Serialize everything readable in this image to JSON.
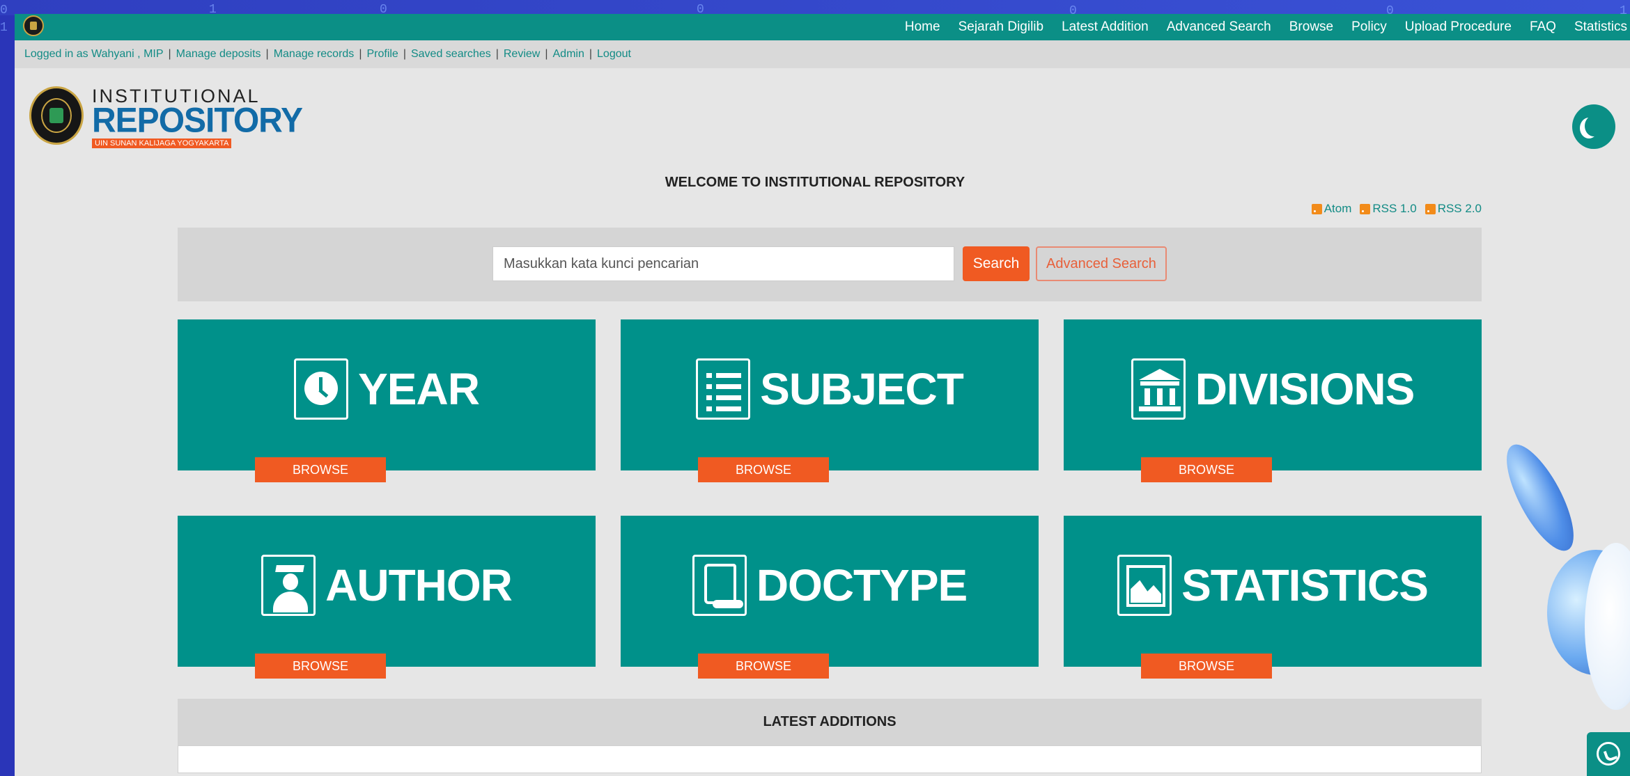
{
  "topnav": {
    "items": [
      "Home",
      "Sejarah Digilib",
      "Latest Addition",
      "Advanced Search",
      "Browse",
      "Policy",
      "Upload Procedure",
      "FAQ",
      "Statistics"
    ]
  },
  "userbar": {
    "logged_in": "Logged in as Wahyani , MIP",
    "links": [
      "Manage deposits",
      "Manage records",
      "Profile",
      "Saved searches",
      "Review",
      "Admin",
      "Logout"
    ]
  },
  "logo": {
    "line1": "INSTITUTIONAL",
    "line2": "REPOSITORY",
    "line3": "UIN SUNAN KALIJAGA YOGYAKARTA"
  },
  "welcome": "WELCOME TO INSTITUTIONAL REPOSITORY",
  "feeds": [
    "Atom",
    "RSS 1.0",
    "RSS 2.0"
  ],
  "search": {
    "placeholder": "Masukkan kata kunci pencarian",
    "search_label": "Search",
    "advanced_label": "Advanced Search"
  },
  "tiles": [
    {
      "label": "YEAR",
      "browse": "BROWSE",
      "icon": "clock-icon"
    },
    {
      "label": "SUBJECT",
      "browse": "BROWSE",
      "icon": "list-icon"
    },
    {
      "label": "DIVISIONS",
      "browse": "BROWSE",
      "icon": "building-icon"
    },
    {
      "label": "AUTHOR",
      "browse": "BROWSE",
      "icon": "graduate-icon"
    },
    {
      "label": "DOCTYPE",
      "browse": "BROWSE",
      "icon": "scroll-icon"
    },
    {
      "label": "STATISTICS",
      "browse": "BROWSE",
      "icon": "area-chart-icon"
    }
  ],
  "latest_title": "LATEST ADDITIONS",
  "colors": {
    "teal": "#00918a",
    "orange": "#f05a22",
    "link": "#128b85"
  }
}
